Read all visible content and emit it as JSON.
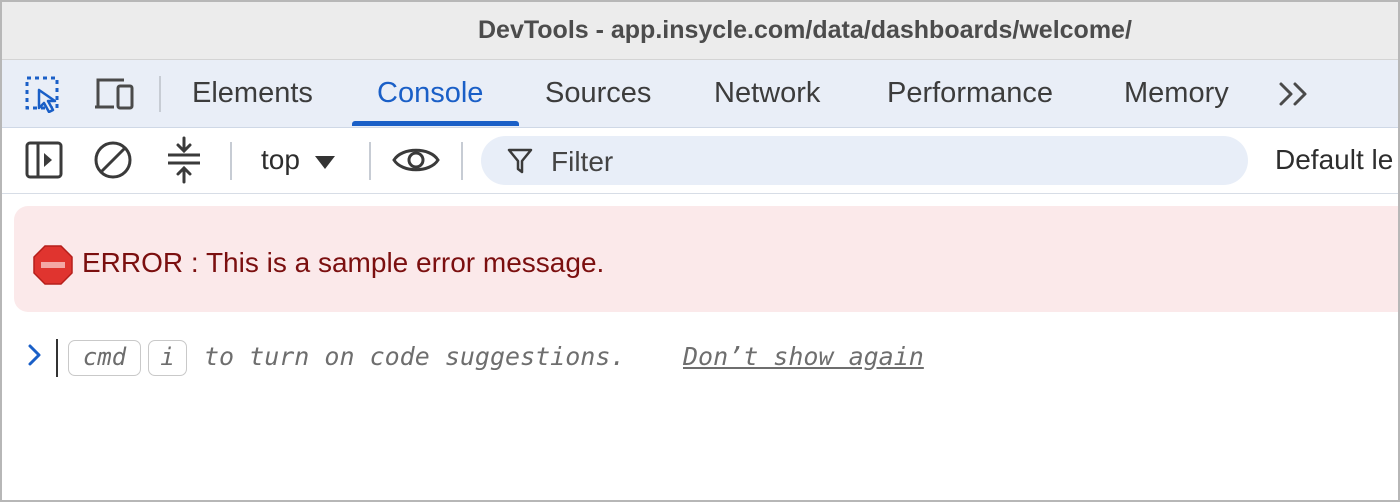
{
  "window": {
    "title": "DevTools - app.insycle.com/data/dashboards/welcome/"
  },
  "tabs": [
    {
      "label": "Elements",
      "active": false
    },
    {
      "label": "Console",
      "active": true
    },
    {
      "label": "Sources",
      "active": false
    },
    {
      "label": "Network",
      "active": false
    },
    {
      "label": "Performance",
      "active": false
    },
    {
      "label": "Memory",
      "active": false
    }
  ],
  "toolbar": {
    "context_value": "top",
    "filter_placeholder": "Filter",
    "levels_label": "Default le"
  },
  "console": {
    "error_message": "ERROR :  This is a sample error message.",
    "hint_key_cmd": "cmd",
    "hint_key_i": "i",
    "hint_text": "to turn on code suggestions.",
    "dont_show_again": "Don’t show again"
  },
  "icons": {
    "inspect": "inspect-element-icon",
    "device": "device-toolbar-icon",
    "more_tabs": "more-tabs-icon",
    "sidebar": "show-sidebar-icon",
    "clear": "clear-console-icon",
    "collapse": "collapse-groups-icon",
    "eye": "live-expression-icon",
    "filter": "filter-icon",
    "error": "error-stop-icon",
    "prompt": "prompt-chevron-icon"
  },
  "colors": {
    "accent": "#1a5fc7",
    "error_bg": "#fbe9ea",
    "error_text": "#7b0f0f",
    "error_icon": "#e0342f"
  }
}
